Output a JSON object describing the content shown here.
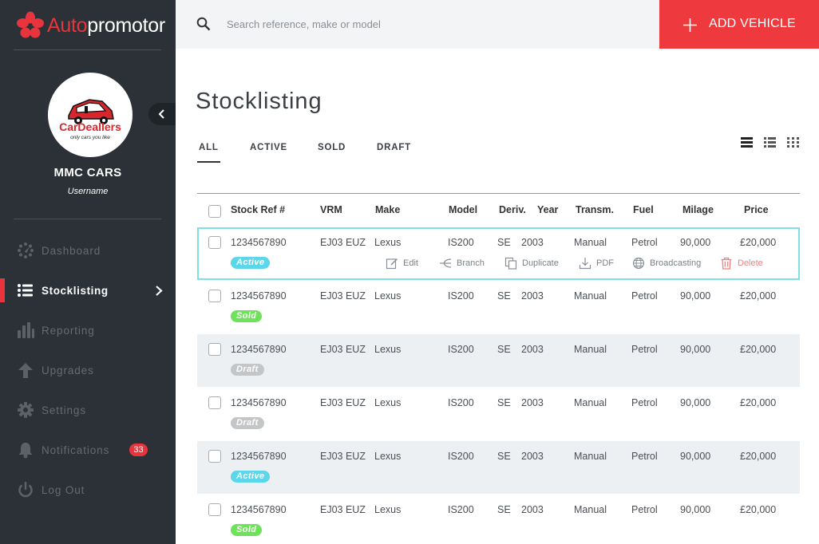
{
  "brand": {
    "part1": "Auto",
    "part2": "promotor",
    "accent": "#e8343c"
  },
  "profile": {
    "company": "MMC CARS",
    "username": "Username",
    "logo_text": "CarDeallers",
    "logo_tagline": "only cars you like"
  },
  "nav": [
    {
      "label": "Dashboard",
      "icon": "dashboard-icon"
    },
    {
      "label": "Stocklisting",
      "icon": "list-icon",
      "active": true
    },
    {
      "label": "Reporting",
      "icon": "bar-chart-icon"
    },
    {
      "label": "Upgrades",
      "icon": "arrow-up-icon"
    },
    {
      "label": "Settings",
      "icon": "gear-icon"
    },
    {
      "label": "Notifications",
      "icon": "bell-icon",
      "badge": "33"
    },
    {
      "label": "Log Out",
      "icon": "power-icon"
    }
  ],
  "search": {
    "placeholder": "Search reference, make or model"
  },
  "add_vehicle": "ADD VEHICLE",
  "page_title": "Stocklisting",
  "tabs": [
    "ALL",
    "ACTIVE",
    "SOLD",
    "DRAFT"
  ],
  "columns": [
    "Stock Ref #",
    "VRM",
    "Make",
    "Model",
    "Deriv.",
    "Year",
    "Transm.",
    "Fuel",
    "Milage",
    "Price"
  ],
  "row_actions": [
    "Edit",
    "Branch",
    "Duplicate",
    "PDF",
    "Broadcasting",
    "Delete"
  ],
  "rows": [
    {
      "ref": "1234567890",
      "vrm": "EJ03 EUZ",
      "make": "Lexus",
      "model": "IS200",
      "deriv": "SE",
      "year": "2003",
      "transm": "Manual",
      "fuel": "Petrol",
      "milage": "90,000",
      "price": "£20,000",
      "status": "Active"
    },
    {
      "ref": "1234567890",
      "vrm": "EJ03 EUZ",
      "make": "Lexus",
      "model": "IS200",
      "deriv": "SE",
      "year": "2003",
      "transm": "Manual",
      "fuel": "Petrol",
      "milage": "90,000",
      "price": "£20,000",
      "status": "Sold"
    },
    {
      "ref": "1234567890",
      "vrm": "EJ03 EUZ",
      "make": "Lexus",
      "model": "IS200",
      "deriv": "SE",
      "year": "2003",
      "transm": "Manual",
      "fuel": "Petrol",
      "milage": "90,000",
      "price": "£20,000",
      "status": "Draft"
    },
    {
      "ref": "1234567890",
      "vrm": "EJ03 EUZ",
      "make": "Lexus",
      "model": "IS200",
      "deriv": "SE",
      "year": "2003",
      "transm": "Manual",
      "fuel": "Petrol",
      "milage": "90,000",
      "price": "£20,000",
      "status": "Draft"
    },
    {
      "ref": "1234567890",
      "vrm": "EJ03 EUZ",
      "make": "Lexus",
      "model": "IS200",
      "deriv": "SE",
      "year": "2003",
      "transm": "Manual",
      "fuel": "Petrol",
      "milage": "90,000",
      "price": "£20,000",
      "status": "Active"
    },
    {
      "ref": "1234567890",
      "vrm": "EJ03 EUZ",
      "make": "Lexus",
      "model": "IS200",
      "deriv": "SE",
      "year": "2003",
      "transm": "Manual",
      "fuel": "Petrol",
      "milage": "90,000",
      "price": "£20,000",
      "status": "Sold"
    }
  ],
  "colors": {
    "sidebar": "#2b3137",
    "add_button": "#ee3a3f",
    "active_status": "#5bd6ea",
    "sold_status": "#6ee25a",
    "draft_status": "#c3c5c7",
    "selected_row_border": "#7fe0e6"
  }
}
